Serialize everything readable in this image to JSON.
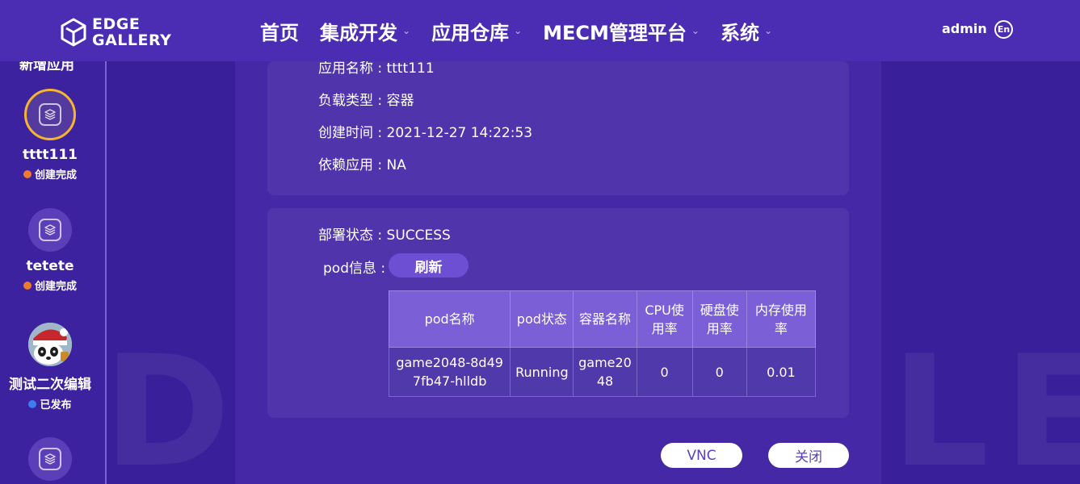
{
  "watermark": "EDGEGALLERY",
  "header": {
    "logo_line1": "EDGE",
    "logo_line2": "GALLERY",
    "nav": [
      {
        "label": "首页",
        "has_menu": false
      },
      {
        "label": "集成开发",
        "has_menu": true
      },
      {
        "label": "应用仓库",
        "has_menu": true
      },
      {
        "label": "MECM管理平台",
        "has_menu": true
      },
      {
        "label": "系统",
        "has_menu": true
      }
    ],
    "user": "admin",
    "lang": "En"
  },
  "sidebar": {
    "top_partial": "新增应用",
    "apps": [
      {
        "name": "tttt111",
        "status": "创建完成",
        "status_color": "#f07a2b",
        "selected": true
      },
      {
        "name": "tetete",
        "status": "创建完成",
        "status_color": "#f07a2b",
        "selected": false
      },
      {
        "name": "测试二次编辑",
        "status": "已发布",
        "status_color": "#3b7cf0",
        "selected": false,
        "avatar": "panda-avatar"
      }
    ]
  },
  "details": {
    "app_name": "应用名称 : tttt111",
    "load_type": "负载类型 : 容器",
    "created_time": "创建时间 : 2021-12-27 14:22:53",
    "dependency": "依赖应用 : NA"
  },
  "deploy": {
    "status": "部署状态 : SUCCESS",
    "pod_info_label": "pod信息 :",
    "refresh_label": "刷新",
    "table": {
      "headers": [
        "pod名称",
        "pod状态",
        "容器名称",
        "CPU使用率",
        "硬盘使用率",
        "内存使用率"
      ],
      "rows": [
        [
          "game2048-8d497fb47-hlldb",
          "Running",
          "game2048",
          "0",
          "0",
          "0.01"
        ]
      ]
    }
  },
  "buttons": {
    "vnc": "VNC",
    "close": "关闭"
  },
  "colors": {
    "accent_selected": "#f5b531",
    "background": "#3a1f9a"
  }
}
